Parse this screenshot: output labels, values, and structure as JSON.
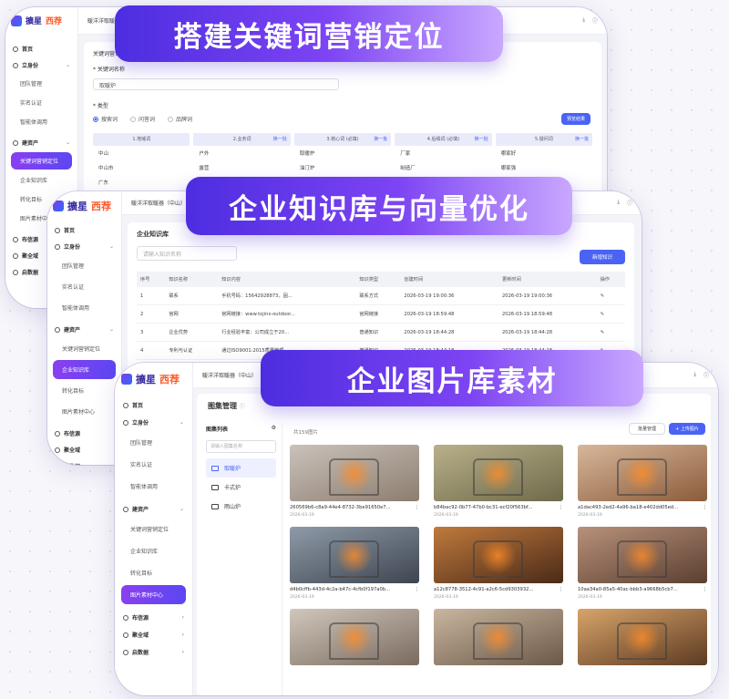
{
  "banners": {
    "b1": "搭建关键词营销定位",
    "b2": "企业知识库与向量优化",
    "b3": "企业图片库素材"
  },
  "brand": {
    "name_a": "擴星",
    "name_b": "西荐"
  },
  "colors": {
    "primary": "#4b63f5",
    "banner_start": "#4d2de0",
    "banner_end": "#c9a8ff",
    "accent": "#ff5a2a"
  },
  "tab_label": "暖洋洋取暖器（中山）",
  "nav": {
    "home": "首页",
    "g1": "立身份",
    "g1_items": [
      "团队管理",
      "实名认证",
      "智能体调用"
    ],
    "g2": "建资产",
    "g2_items": [
      "关键词营销定位",
      "企业知识库",
      "转化目标",
      "图片素材中心"
    ],
    "g3": "布信源",
    "g4": "聚全域",
    "g5": "启数据"
  },
  "w1": {
    "crumb": "关键词营销",
    "field_label": "* 关键词名称",
    "field_value": "取暖炉",
    "type_label": "* 类型",
    "radios": [
      "搜索词",
      "问答词",
      "品牌词"
    ],
    "gen_button": "预览结果",
    "columns": [
      {
        "head": "1.地域词",
        "more": "",
        "items": [
          "中山",
          "中山市",
          "广东",
          "广东省"
        ]
      },
      {
        "head": "2.业务词",
        "more": "换一批",
        "items": [
          "户外",
          "露营",
          "",
          ""
        ]
      },
      {
        "head": "3.核心词 (必填)",
        "more": "换一批",
        "items": [
          "取暖炉",
          "油汀炉",
          "",
          ""
        ]
      },
      {
        "head": "4.后缀词 (必填)",
        "more": "换一批",
        "items": [
          "厂家",
          "制造厂",
          "",
          ""
        ]
      },
      {
        "head": "5.疑问词",
        "more": "换一批",
        "items": [
          "哪家好",
          "哪家强",
          "",
          ""
        ]
      }
    ]
  },
  "w2": {
    "title": "企业知识库",
    "search_placeholder": "请输入知识名称",
    "add_button": "新增知识",
    "headers": [
      "序号",
      "知识名称",
      "知识内容",
      "知识类型",
      "创建时间",
      "更新时间",
      "操作"
    ],
    "rows": [
      [
        "1",
        "联系",
        "手机号码：15642928873，固...",
        "联系方式",
        "2026-03-19 19:00:36",
        "2026-03-19 19:00:36"
      ],
      [
        "2",
        "官网",
        "官网链接：www.tojins-outdoor...",
        "官网链接",
        "2026-03-19 18:59:48",
        "2026-03-19 18:59:48"
      ],
      [
        "3",
        "企业优势",
        "行业经验丰富：公司成立于20...",
        "普通知识",
        "2026-03-19 18:44:28",
        "2026-03-19 18:44:28"
      ],
      [
        "4",
        "专利与认证",
        "通过ISO9001:2015质量管理...",
        "普通知识",
        "2026-03-19 18:44:18",
        "2026-03-19 18:44:18"
      ],
      [
        "5",
        "产品与服务",
        "",
        "",
        "",
        ""
      ]
    ]
  },
  "w3": {
    "title": "图集管理",
    "album_head": "图集列表",
    "album_search": "请输入图集名称",
    "albums": [
      "取暖炉",
      "卡式炉",
      "雨山炉"
    ],
    "count": "共159图片",
    "batch_button": "批量管理",
    "upload_button": "+ 上传图片",
    "images": [
      {
        "name": "260569b6-c8a9-44e4-8732-3be91650e7...",
        "date": "2026-03-19"
      },
      {
        "name": "b84bac92-0b77-47b0-bc31-ecf20f563bf...",
        "date": "2026-03-19"
      },
      {
        "name": "a1dac493-2ed2-4a96-ba18-e402dd05ed...",
        "date": "2026-03-19"
      },
      {
        "name": "d4b0cffb-443d-4c2a-b47c-4cfb0f197a0b...",
        "date": "2026-03-19"
      },
      {
        "name": "a12c8778-3512-4c91-a2c6-5cd9303932...",
        "date": "2026-03-19"
      },
      {
        "name": "10aa34a0-85a5-40ac-bbb3-a9668b5cb7...",
        "date": "2026-03-19"
      },
      {
        "name": "",
        "date": ""
      },
      {
        "name": "",
        "date": ""
      },
      {
        "name": "",
        "date": ""
      }
    ]
  }
}
